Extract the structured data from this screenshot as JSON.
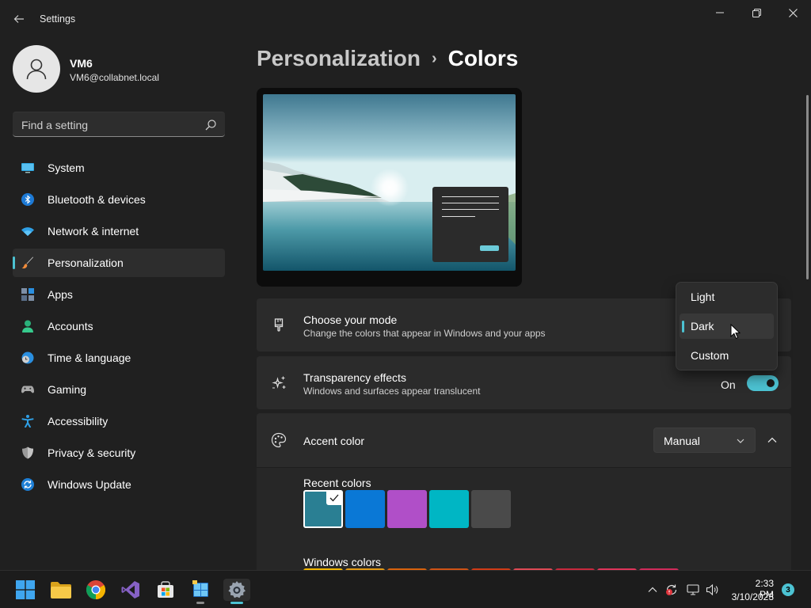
{
  "window": {
    "title": "Settings"
  },
  "profile": {
    "name": "VM6",
    "email": "VM6@collabnet.local"
  },
  "search": {
    "placeholder": "Find a setting"
  },
  "sidebar": {
    "items": [
      {
        "label": "System",
        "icon": "monitor-icon"
      },
      {
        "label": "Bluetooth & devices",
        "icon": "bluetooth-icon"
      },
      {
        "label": "Network & internet",
        "icon": "wifi-icon"
      },
      {
        "label": "Personalization",
        "icon": "brush-icon",
        "active": true
      },
      {
        "label": "Apps",
        "icon": "apps-icon"
      },
      {
        "label": "Accounts",
        "icon": "person-icon"
      },
      {
        "label": "Time & language",
        "icon": "clock-globe-icon"
      },
      {
        "label": "Gaming",
        "icon": "gamepad-icon"
      },
      {
        "label": "Accessibility",
        "icon": "accessibility-icon"
      },
      {
        "label": "Privacy & security",
        "icon": "shield-icon"
      },
      {
        "label": "Windows Update",
        "icon": "update-icon"
      }
    ]
  },
  "breadcrumb": {
    "parent": "Personalization",
    "separator": "›",
    "current": "Colors"
  },
  "mode": {
    "title": "Choose your mode",
    "description": "Change the colors that appear in Windows and your apps",
    "options": [
      "Light",
      "Dark",
      "Custom"
    ],
    "selected": "Dark"
  },
  "transparency": {
    "title": "Transparency effects",
    "description": "Windows and surfaces appear translucent",
    "state_label": "On",
    "enabled": true
  },
  "accent": {
    "title": "Accent color",
    "mode_value": "Manual",
    "recent_label": "Recent colors",
    "recent_colors": [
      "#2a7f93",
      "#0a78d6",
      "#b04fc8",
      "#00b6c4",
      "#4a4a4a"
    ],
    "selected_index": 0,
    "windows_label": "Windows colors",
    "windows_colors": [
      "#f2b600",
      "#e49b14",
      "#d9620c",
      "#cf5215",
      "#d13b16",
      "#e04a55",
      "#c8283d",
      "#e0345a",
      "#d12a5a"
    ]
  },
  "colors": {
    "accent": "#4cc2d2",
    "background": "#202020",
    "card": "#2b2b2b"
  },
  "taskbar": {
    "time": "2:33 PM",
    "date": "3/10/2023",
    "notifications": "3"
  }
}
